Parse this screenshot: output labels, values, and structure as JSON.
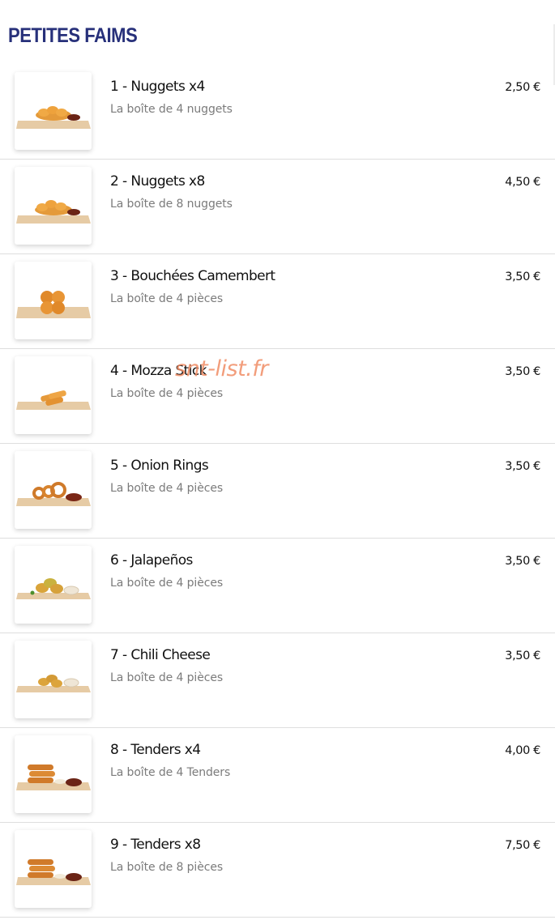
{
  "section": {
    "title": "PETITES FAIMS"
  },
  "watermark": "snt-list.fr",
  "items": [
    {
      "name": "1 - Nuggets x4",
      "description": "La boîte de 4 nuggets",
      "price": "2,50 €",
      "image": "nuggets"
    },
    {
      "name": "2 - Nuggets x8",
      "description": "La boîte de 8 nuggets",
      "price": "4,50 €",
      "image": "nuggets"
    },
    {
      "name": "3 - Bouchées Camembert",
      "description": "La boîte de 4 pièces",
      "price": "3,50 €",
      "image": "camembert-bites"
    },
    {
      "name": "4 - Mozza Stick",
      "description": "La boîte de 4 pièces",
      "price": "3,50 €",
      "image": "mozza-sticks"
    },
    {
      "name": "5 - Onion Rings",
      "description": "La boîte de 4 pièces",
      "price": "3,50 €",
      "image": "onion-rings"
    },
    {
      "name": "6 - Jalapeños",
      "description": "La boîte de 4 pièces",
      "price": "3,50 €",
      "image": "jalapenos"
    },
    {
      "name": "7 - Chili Cheese",
      "description": "La boîte de 4 pièces",
      "price": "3,50 €",
      "image": "chili-cheese"
    },
    {
      "name": "8 - Tenders x4",
      "description": "La boîte de 4 Tenders",
      "price": "4,00 €",
      "image": "tenders"
    },
    {
      "name": "9 - Tenders x8",
      "description": "La boîte de 8 pièces",
      "price": "7,50 €",
      "image": "tenders"
    }
  ]
}
